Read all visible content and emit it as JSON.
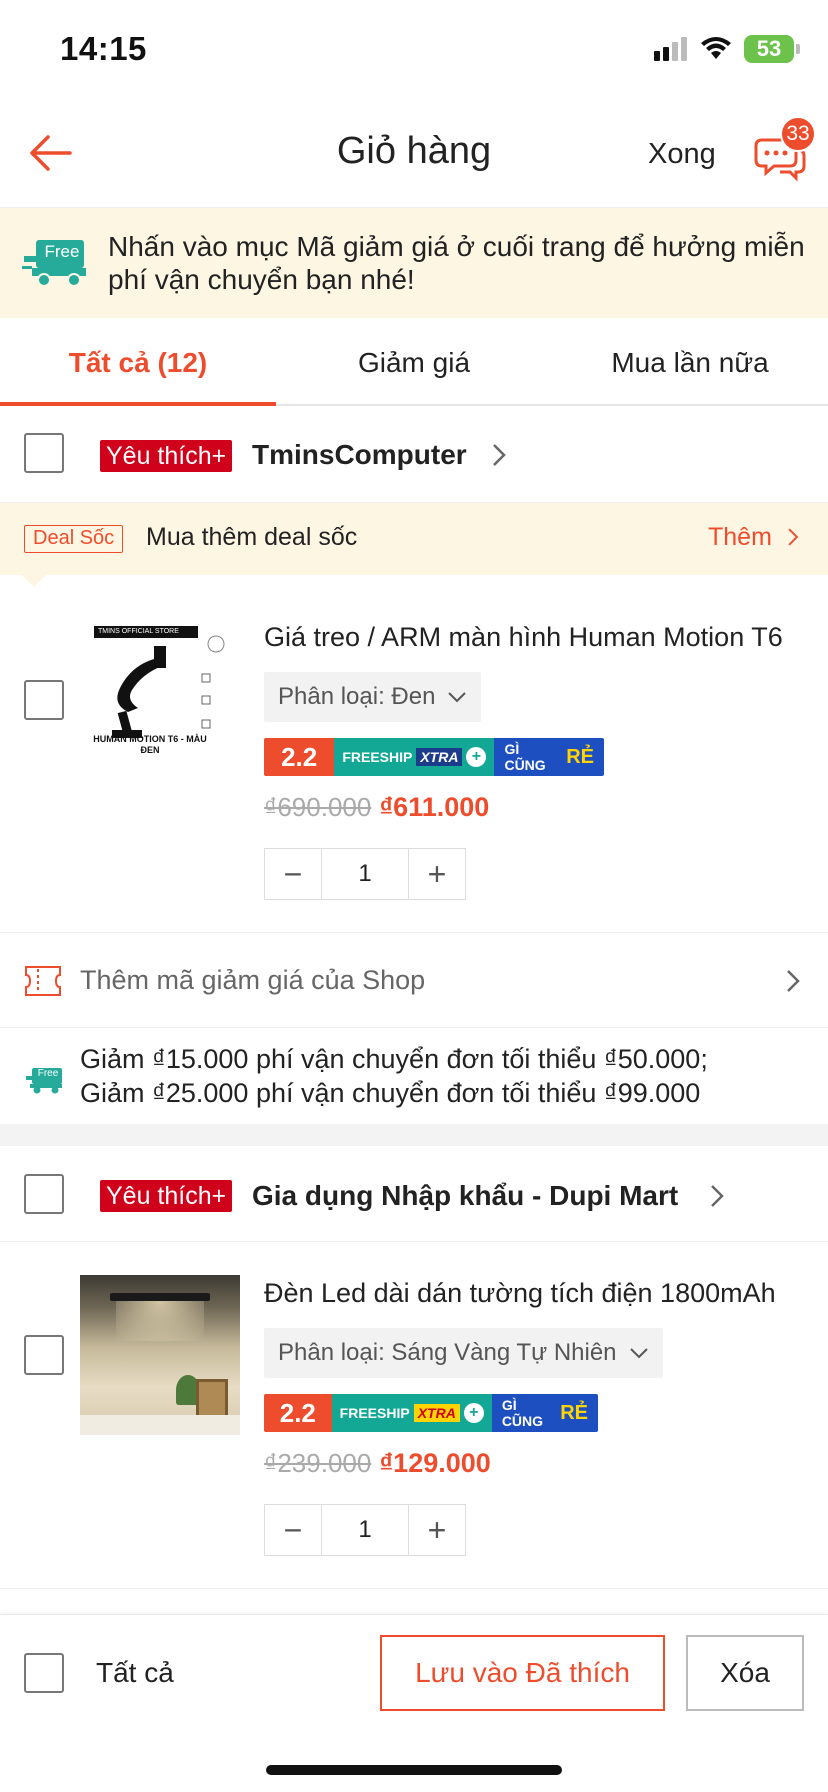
{
  "status_bar": {
    "time": "14:15",
    "battery": "53"
  },
  "header": {
    "title": "Giỏ hàng",
    "done_label": "Xong",
    "chat_badge": "33"
  },
  "banner": {
    "badge": "Free",
    "text": "Nhấn vào mục Mã giảm giá ở cuối trang để hưởng miễn phí vận chuyển bạn nhé!"
  },
  "tabs": [
    {
      "label": "Tất cả (12)",
      "active": true
    },
    {
      "label": "Giảm giá",
      "active": false
    },
    {
      "label": "Mua lần nữa",
      "active": false
    }
  ],
  "shops": [
    {
      "badge": "Yêu thích+",
      "name": "TminsComputer",
      "deal": {
        "tag": "Deal Sốc",
        "text": "Mua thêm deal sốc",
        "more": "Thêm"
      },
      "product": {
        "name": "Giá treo / ARM màn hình Human Motion T6",
        "variant": "Phân loại: Đen",
        "image_caption": "HUMAN MOTION T6 - MÀU ĐEN",
        "image_brand": "TMINS OFFICIAL STORE",
        "promo": {
          "num": "2.2",
          "freeship": "FREESHIP",
          "xtra": "XTRA",
          "cheap": "GÌ CŨNG",
          "cheap_word": "RẺ"
        },
        "price_old": "₫690.000",
        "price_new": "₫611.000",
        "quantity": "1"
      },
      "voucher_label": "Thêm mã giảm giá của Shop",
      "shipping": {
        "badge": "Free",
        "line1": "Giảm ₫15.000 phí vận chuyển đơn tối thiểu ₫50.000;",
        "line2": "Giảm ₫25.000 phí vận chuyển đơn tối thiểu ₫99.000"
      }
    },
    {
      "badge": "Yêu thích+",
      "name": "Gia dụng Nhập khẩu - Dupi Mart",
      "product": {
        "name": "Đèn Led dài dán tường tích điện 1800mAh",
        "variant": "Phân loại: Sáng Vàng Tự Nhiên",
        "promo": {
          "num": "2.2",
          "freeship": "FREESHIP",
          "xtra": "XTRA",
          "cheap": "GÌ CŨNG",
          "cheap_word": "RẺ"
        },
        "price_old": "₫239.000",
        "price_new": "₫129.000",
        "quantity": "1"
      }
    }
  ],
  "bottom": {
    "select_all": "Tất cả",
    "save_label": "Lưu vào Đã thích",
    "delete_label": "Xóa"
  },
  "colors": {
    "accent": "#ee4d2d",
    "banner_bg": "#fdf6e3",
    "free_green": "#26aa99"
  }
}
